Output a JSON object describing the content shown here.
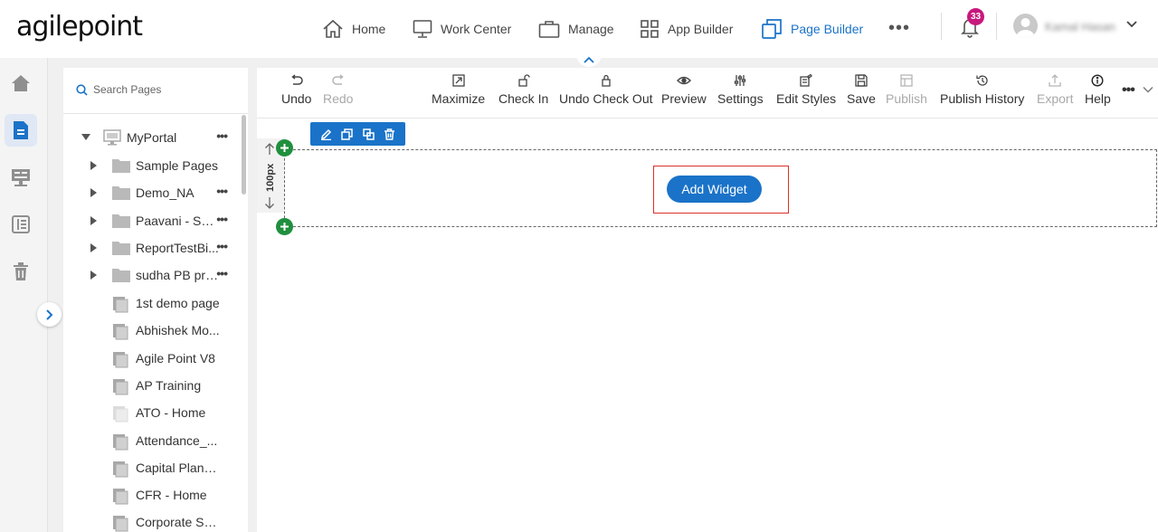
{
  "app": {
    "logo_text": "agilepoint",
    "brand_color": "#1a73c8"
  },
  "topnav": {
    "items": [
      {
        "label": "Home",
        "icon": "home-icon"
      },
      {
        "label": "Work Center",
        "icon": "monitor-icon"
      },
      {
        "label": "Manage",
        "icon": "briefcase-icon"
      },
      {
        "label": "App Builder",
        "icon": "grid-icon"
      },
      {
        "label": "Page Builder",
        "icon": "pages-icon",
        "active": true
      }
    ],
    "more_label": "•••",
    "notification_count": "33",
    "user_name": "Kamal Hasan"
  },
  "rail": {
    "items": [
      "home-icon",
      "page-icon",
      "form-icon",
      "list-icon",
      "trash-icon"
    ],
    "active": "page-icon"
  },
  "tree": {
    "search_placeholder": "Search Pages",
    "root": {
      "label": "MyPortal",
      "more": "•••"
    },
    "folders": [
      {
        "label": "Sample Pages",
        "more": ""
      },
      {
        "label": "Demo_NA",
        "more": "•••"
      },
      {
        "label": "Paavani - SMS",
        "more": "•••"
      },
      {
        "label": "ReportTestBi...",
        "more": "•••"
      },
      {
        "label": "sudha PB pra...",
        "more": "•••"
      }
    ],
    "pages": [
      {
        "label": "1st demo page"
      },
      {
        "label": "Abhishek Mo..."
      },
      {
        "label": "Agile Point V8"
      },
      {
        "label": "AP Training"
      },
      {
        "label": "ATO - Home",
        "faded": true
      },
      {
        "label": "Attendance_..."
      },
      {
        "label": "Capital Planni..."
      },
      {
        "label": "CFR - Home"
      },
      {
        "label": "Corporate Saf..."
      }
    ]
  },
  "toolbar": {
    "undo": "Undo",
    "redo": "Redo",
    "maximize": "Maximize",
    "check_in": "Check In",
    "undo_check_out": "Undo Check Out",
    "preview": "Preview",
    "settings": "Settings",
    "edit_styles": "Edit Styles",
    "save": "Save",
    "publish": "Publish",
    "publish_history": "Publish History",
    "export": "Export",
    "help": "Help",
    "more": "•••"
  },
  "canvas": {
    "row_height_label": "100px",
    "add_widget_label": "Add Widget"
  }
}
